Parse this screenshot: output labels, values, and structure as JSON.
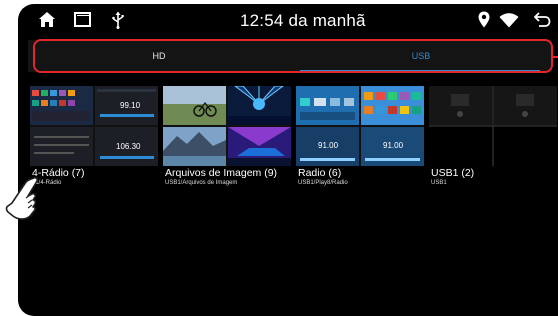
{
  "statusbar": {
    "time": "12:54 da manhã",
    "icons": [
      "home-icon",
      "recent-apps-icon",
      "usb-icon",
      "location-icon",
      "wifi-icon",
      "back-icon"
    ]
  },
  "tabs": [
    {
      "label": "HD",
      "selected": false
    },
    {
      "label": "USB",
      "selected": true
    }
  ],
  "folders": [
    {
      "title": "4-Rádio  (7)",
      "path": "..1/4-Rádio"
    },
    {
      "title": "Arquivos de Imagem  (9)",
      "path": "USB1/Arquivos de Imagem"
    },
    {
      "title": "Radio  (6)",
      "path": "USB1/Play8/Radio"
    },
    {
      "title": "USB1  (2)",
      "path": "USB1"
    }
  ],
  "thumbnail_text": {
    "radio_freq_a": "99.10",
    "radio_freq_b": "106.30",
    "radio_freq_c": "91.00"
  },
  "colors": {
    "accent": "#2e8bd8",
    "highlight": "#e3262a",
    "background": "#000000"
  }
}
